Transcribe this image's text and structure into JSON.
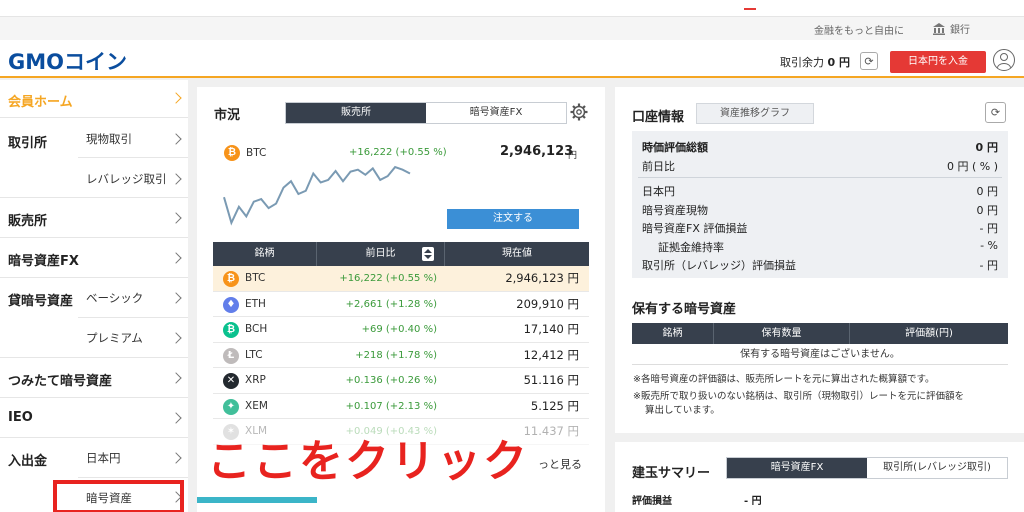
{
  "topbar": {
    "tagline": "金融をもっと自由に",
    "bank": "銀行"
  },
  "header": {
    "logo_gmo": "GMO",
    "logo_coin": "コイン",
    "balance_label": "取引余力",
    "balance_value": "0 円",
    "deposit_button": "日本円を入金"
  },
  "sidebar": {
    "home": "会員ホーム",
    "exchange": "取引所",
    "exchange_spot": "現物取引",
    "exchange_leverage": "レバレッジ取引",
    "sales": "販売所",
    "crypto_fx": "暗号資産FX",
    "lending": "貸暗号資産",
    "lending_basic": "ベーシック",
    "lending_premium": "プレミアム",
    "tsumitate": "つみたて暗号資産",
    "ieo": "IEO",
    "deposit": "入出金",
    "deposit_jpy": "日本円",
    "deposit_crypto": "暗号資産"
  },
  "market": {
    "title": "市況",
    "tab_sales": "販売所",
    "tab_fx": "暗号資産FX",
    "featured": {
      "symbol": "BTC",
      "change": "+16,222 (+0.55 %)",
      "price": "2,946,123",
      "unit": "円"
    },
    "order_button": "注文する",
    "headers": [
      "銘柄",
      "前日比",
      "現在値"
    ],
    "rows": [
      {
        "symbol": "BTC",
        "change": "+16,222 (+0.55 %)",
        "price": "2,946,123 円",
        "color": "#f7931a",
        "glyph": "₿"
      },
      {
        "symbol": "ETH",
        "change": "+2,661 (+1.28 %)",
        "price": "209,910 円",
        "color": "#627eea",
        "glyph": "♦"
      },
      {
        "symbol": "BCH",
        "change": "+69 (+0.40 %)",
        "price": "17,140 円",
        "color": "#0ac18e",
        "glyph": "₿"
      },
      {
        "symbol": "LTC",
        "change": "+218 (+1.78 %)",
        "price": "12,412 円",
        "color": "#bfbbbb",
        "glyph": "Ł"
      },
      {
        "symbol": "XRP",
        "change": "+0.136 (+0.26 %)",
        "price": "51.116 円",
        "color": "#23292f",
        "glyph": "✕"
      },
      {
        "symbol": "XEM",
        "change": "+0.107 (+2.13 %)",
        "price": "5.125 円",
        "color": "#41bf9a",
        "glyph": "✦"
      },
      {
        "symbol": "XLM",
        "change": "+0.049 (+0.43 %)",
        "price": "11.437 円",
        "color": "#aaaaaa",
        "glyph": "✶"
      }
    ],
    "more_link": "っと見る",
    "sparkline": [
      0.55,
      0.95,
      0.7,
      0.85,
      0.62,
      0.58,
      0.72,
      0.65,
      0.4,
      0.3,
      0.5,
      0.45,
      0.18,
      0.32,
      0.28,
      0.14,
      0.3,
      0.15,
      0.12,
      0.2,
      0.1,
      0.28,
      0.22,
      0.08,
      0.12,
      0.18
    ]
  },
  "overlay": {
    "text": "ここをクリック"
  },
  "account": {
    "title": "口座情報",
    "asset_graph_button": "資産推移グラフ",
    "rows_top": [
      {
        "label": "時価評価総額",
        "value": "0 円",
        "bold": true
      },
      {
        "label": "前日比",
        "value": "0 円 ( % )"
      }
    ],
    "rows_bottom": [
      {
        "label": "日本円",
        "value": "0 円"
      },
      {
        "label": "暗号資産現物",
        "value": "0 円"
      },
      {
        "label": "暗号資産FX 評価損益",
        "value": "- 円"
      },
      {
        "label": "証拠金維持率",
        "value": "- %",
        "indent": true
      },
      {
        "label": "取引所（レバレッジ）評価損益",
        "value": "- 円"
      }
    ]
  },
  "holdings": {
    "title": "保有する暗号資産",
    "headers": [
      "銘柄",
      "保有数量",
      "評価額(円)"
    ],
    "empty": "保有する暗号資産はございません。",
    "note1": "※各暗号資産の評価額は、販売所レートを元に算出された概算額です。",
    "note2a": "※販売所で取り扱いのない銘柄は、取引所（現物取引）レートを元に評価額を",
    "note2b": "算出しています。"
  },
  "summary": {
    "title": "建玉サマリー",
    "tab_fx": "暗号資産FX",
    "tab_exchange": "取引所(レバレッジ取引)",
    "pl_label": "評価損益",
    "pl_value": "- 円"
  }
}
